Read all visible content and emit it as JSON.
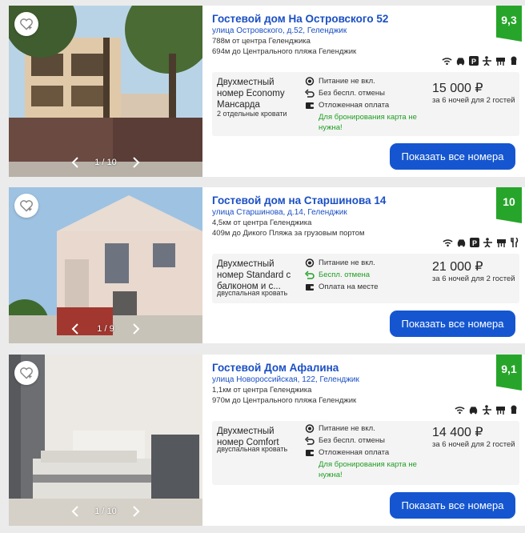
{
  "currency_sign": "₽",
  "colors": {
    "rating_bg": "#27a52a",
    "link": "#1a4fc4",
    "button": "#1556d0",
    "green": "#1f9e23"
  },
  "cards": [
    {
      "title": "Гостевой дом На Островского 52",
      "address": "улица Островского, д.52, Геленджик",
      "dist1": "788м от центра Геленджика",
      "dist2": "694м до Центрального пляжа Геленджик",
      "rating": "9,3",
      "amenities": [
        "wifi-icon",
        "car-icon",
        "parking-icon",
        "kids-icon",
        "bbq-icon",
        "chef-icon"
      ],
      "gallery": "1 / 10",
      "room_name": "Двухместный номер Economy Мансарда",
      "bed": "2 отдельные кровати",
      "features": [
        "Питание не вкл.",
        "Без беспл. отмены",
        "Отложенная оплата"
      ],
      "note": "Для бронирования карта не нужна!",
      "price": "15 000 ₽",
      "per": "за 6 ночей для 2 гостей",
      "button": "Показать все номера"
    },
    {
      "title": "Гостевой дом на Старшинова 14",
      "address": "улица Старшинова, д.14, Геленджик",
      "dist1": "4,5км от центра Геленджика",
      "dist2": "409м до Дикого Пляжа за грузовым портом",
      "rating": "10",
      "amenities": [
        "wifi-icon",
        "car-icon",
        "parking-icon",
        "kids-icon",
        "bbq-icon",
        "restaurant-icon"
      ],
      "gallery": "1 / 9",
      "room_name": "Двухместный номер Standard с балконом и с...",
      "bed": "двуспальная кровать",
      "features": [
        "Питание не вкл.",
        "Беспл. отмена",
        "Оплата на месте"
      ],
      "note": "",
      "price": "21 000 ₽",
      "per": "за 6 ночей для 2 гостей",
      "button": "Показать все номера"
    },
    {
      "title": "Гостевой Дом Афалина",
      "address": "улица Новороссийская, 122, Геленджик",
      "dist1": "1,1км от центра Геленджика",
      "dist2": "970м до Центрального пляжа Геленджик",
      "rating": "9,1",
      "amenities": [
        "wifi-icon",
        "car-icon",
        "kids-icon",
        "bbq-icon",
        "chef-icon"
      ],
      "gallery": "1 / 10",
      "room_name": "Двухместный номер Comfort",
      "bed": "двуспальная кровать",
      "features": [
        "Питание не вкл.",
        "Без беспл. отмены",
        "Отложенная оплата"
      ],
      "note": "Для бронирования карта не нужна!",
      "price": "14 400 ₽",
      "per": "за 6 ночей для 2 гостей",
      "button": "Показать все номера"
    }
  ]
}
